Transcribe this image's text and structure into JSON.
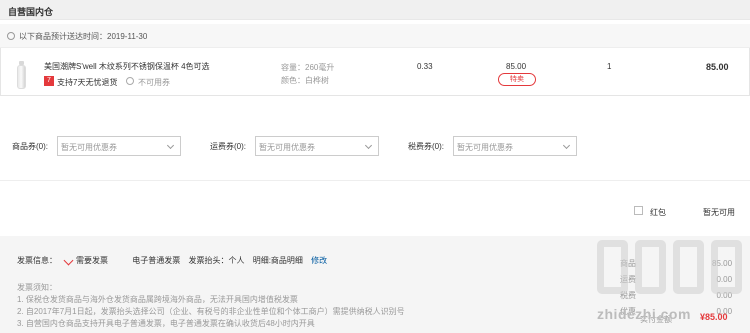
{
  "section": {
    "title": "自营国内仓"
  },
  "delivery": {
    "text": "以下商品预计送达时间：2019-11-30"
  },
  "item": {
    "name": "美国潮牌S'well 木纹系列不锈钢保温杯 4色可选",
    "badge": "7",
    "support": "支持7天无忧退货",
    "coupon_status": "不可用券",
    "capacity": "容量：260毫升",
    "color": "颜色：白桦树",
    "weight": "0.33",
    "price": "85.00",
    "tag": "特卖",
    "quantity": "1",
    "subtotal": "85.00"
  },
  "coupons": [
    {
      "label": "商品券(0):",
      "placeholder": "暂无可用优惠券"
    },
    {
      "label": "运费券(0):",
      "placeholder": "暂无可用优惠券"
    },
    {
      "label": "税费券(0):",
      "placeholder": "暂无可用优惠券"
    }
  ],
  "redbag": {
    "label": "红包",
    "value": "暂无可用"
  },
  "invoice": {
    "label": "发票信息：",
    "need": "需要发票",
    "type": "电子普通发票",
    "title": "发票抬头：个人",
    "detail": "明细:商品明细",
    "edit": "修改",
    "notes_title": "发票须知：",
    "notes": [
      "1. 保税仓发货商品与海外仓发货商品属跨境海外商品，无法开具国内增值税发票",
      "2. 自2017年7月1日起，发票抬头选择公司（企业、有税号的非企业性单位和个体工商户）需提供纳税人识别号",
      "3. 自营国内仓商品支持开具电子普通发票，电子普通发票在确认收货后48小时内开具"
    ]
  },
  "summary": {
    "labels": [
      "商品",
      "运费",
      "税费",
      "优惠",
      "实付金额"
    ],
    "values": [
      "85.00",
      "0.00",
      "0.00",
      "0.00",
      "¥85.00"
    ]
  },
  "watermark": {
    "text": "zhidezhi.com"
  }
}
